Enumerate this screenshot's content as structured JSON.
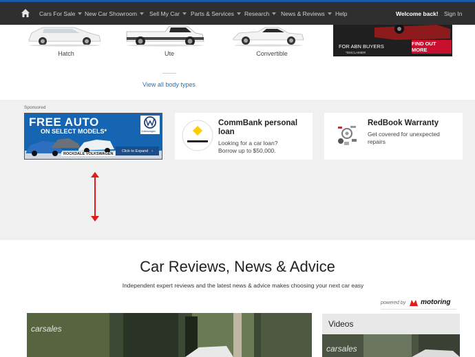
{
  "nav": {
    "home_icon": "home-icon",
    "items": [
      {
        "label": "Cars For Sale",
        "has_caret": true
      },
      {
        "label": "New Car Showroom",
        "has_caret": true
      },
      {
        "label": "Sell My Car",
        "has_caret": true
      },
      {
        "label": "Parts & Services",
        "has_caret": true
      },
      {
        "label": "Research",
        "has_caret": true
      },
      {
        "label": "News & Reviews",
        "has_caret": true
      },
      {
        "label": "Help",
        "has_caret": false
      }
    ],
    "welcome": "Welcome back!",
    "signin": "Sign In",
    "colors": {
      "bar": "#2f2f2f",
      "accent": "#1c57a5"
    }
  },
  "body_types": {
    "items": [
      "Hatch",
      "Ute",
      "Convertible"
    ],
    "view_all": "View all body types"
  },
  "top_ad": {
    "tagline": "FOR ABN BUYERS",
    "disclaimer": "*DISCLAIMER",
    "cta": "FIND OUT MORE"
  },
  "sponsored": {
    "label": "Sponsored",
    "vw_ad": {
      "title": "FREE AUTO",
      "subtitle": "ON SELECT MODELS*",
      "logo_text": "Volkswagen",
      "cta": "Click to Expand",
      "dealer": "ROCKDALE VOLKSWAGEN"
    },
    "cards": [
      {
        "title": "CommBank personal loan",
        "title_line1": "CommBank personal",
        "title_line2": "loan",
        "desc_line1": "Looking for a car loan?",
        "desc_line2": "Borrow up to $50,000.",
        "icon": "commbank-logo-icon"
      },
      {
        "title": "RedBook Warranty",
        "desc_line1": "Get covered for unexpected",
        "desc_line2": "repairs",
        "icon": "car-parts-icon"
      }
    ]
  },
  "reviews": {
    "title": "Car Reviews, News & Advice",
    "subtitle": "Independent expert reviews and the latest news & advice makes choosing your next car easy",
    "powered_by": "powered by",
    "powered_brand": "motoring",
    "videos_label": "Videos",
    "watermark": "carsales"
  }
}
